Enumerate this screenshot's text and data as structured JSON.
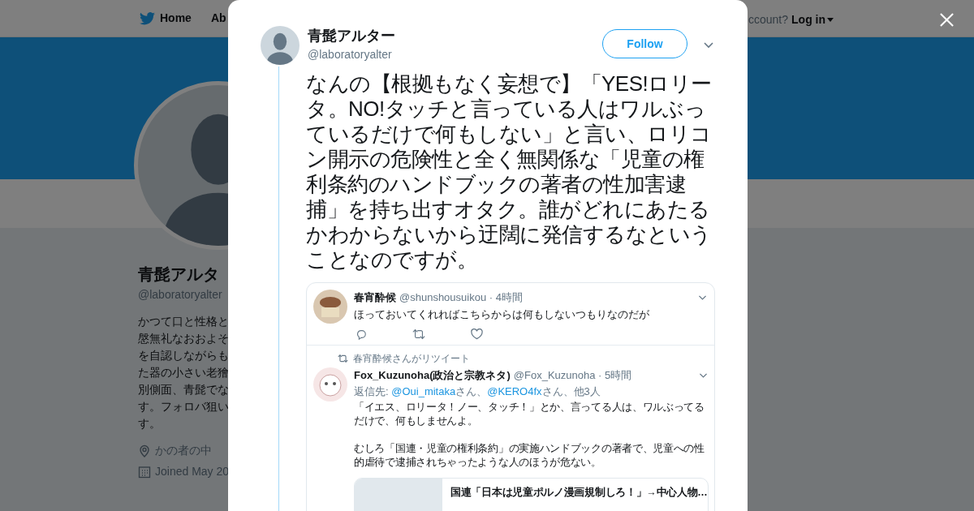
{
  "background_page": {
    "nav": {
      "home": "Home",
      "about": "Ab",
      "account_prompt": "ccount?",
      "login": "Log in"
    },
    "profile": {
      "name": "青髭アルタ",
      "handle": "@laboratoryalter",
      "bio_lines": [
        "かつて口と性格と",
        "慇無礼なおおよそ",
        "を自認しながらも",
        "た器の小さい老獪",
        "別側面、青髭でな",
        "す。フォロバ狙い",
        "す。"
      ],
      "location": "かの者の中",
      "joined": "Joined May 20"
    }
  },
  "modal": {
    "author": {
      "name": "青髭アルター",
      "handle": "@laboratoryalter"
    },
    "follow_button": "Follow",
    "text": "なんの【根拠もなく妄想で】「YES!ロリータ。NO!タッチと言っている人はワルぶっているだけで何もしない」と言い、ロリコン開示の危険性と全く無関係な「児童の権利条約のハンドブックの著者の性加害逮捕」を持ち出すオタク。誰がどれにあたるかわからないから迂闊に発信するなということなのですが。",
    "attached_screenshot": {
      "tweet": {
        "name": "春宵酔候",
        "handle_time": "@shunshousuikou · 4時間",
        "text": "ほっておいてくれればこちらからは何もしないつもりなのだが"
      },
      "retweet_note": "春宵酔候さんがリツイート",
      "retweeted": {
        "name": "Fox_Kuzunoha(政治と宗教ネタ)",
        "handle_time": "@Fox_Kuzunoha · 5時間",
        "reply_to": {
          "prefix": "返信先: ",
          "mentions": [
            {
              "handle": "@Oui_mitaka",
              "suffix": "さん、"
            },
            {
              "handle": "@KERO4fx",
              "suffix": "さん、"
            }
          ],
          "rest": "他3人"
        },
        "paragraphs": [
          "「イエス、ロリータ！ノー、タッチ！」とか、言ってる人は、ワルぶってるだけで、何もしませんよ。",
          "むしろ「国連・児童の権利条約」の実施ハンドブックの著者で、児童への性的虐待で逮捕されちゃったような人のほうが危ない。"
        ],
        "card_title": "国連「日本は児童ポルノ漫画規制しろ！」→中心人物…"
      }
    }
  }
}
